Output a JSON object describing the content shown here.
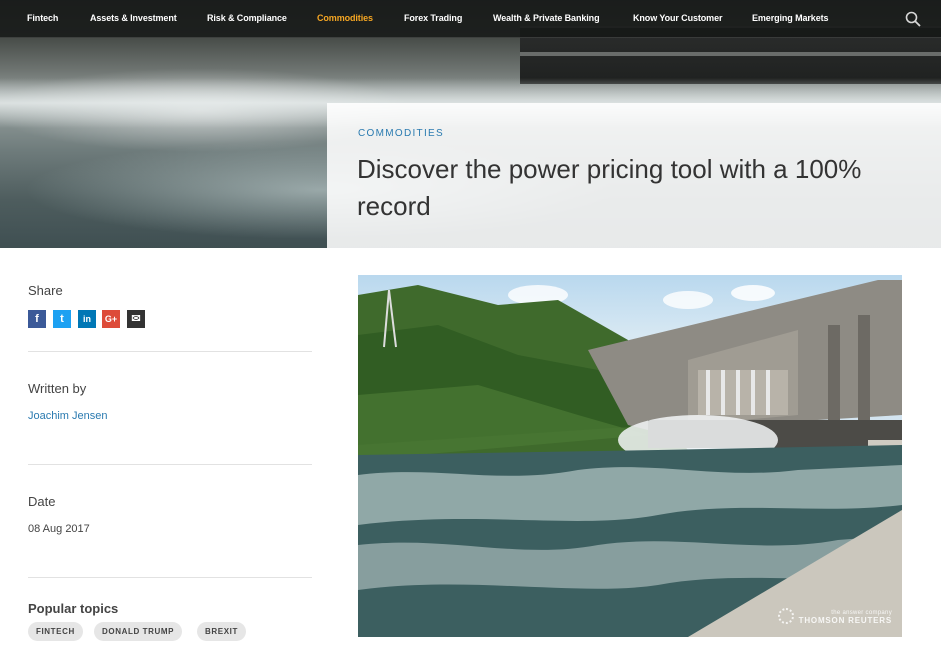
{
  "nav": {
    "items": [
      {
        "label": "Fintech",
        "active": false
      },
      {
        "label": "Assets & Investment",
        "active": false
      },
      {
        "label": "Risk & Compliance",
        "active": false
      },
      {
        "label": "Commodities",
        "active": true
      },
      {
        "label": "Forex Trading",
        "active": false
      },
      {
        "label": "Wealth & Private Banking",
        "active": false
      },
      {
        "label": "Know Your Customer",
        "active": false
      },
      {
        "label": "Emerging Markets",
        "active": false
      }
    ],
    "search_icon": "search-icon"
  },
  "hero": {
    "category": "COMMODITIES",
    "title": "Discover the power pricing tool with a 100% record"
  },
  "sidebar": {
    "share_heading": "Share",
    "share_icons": [
      {
        "name": "facebook-icon",
        "glyph": "f",
        "color": "#3b5998"
      },
      {
        "name": "twitter-icon",
        "glyph": "t",
        "color": "#1da1f2"
      },
      {
        "name": "linkedin-icon",
        "glyph": "in",
        "color": "#0077b5"
      },
      {
        "name": "google-plus-icon",
        "glyph": "G+",
        "color": "#dd4b39"
      },
      {
        "name": "email-icon",
        "glyph": "✉",
        "color": "#333333"
      }
    ],
    "written_heading": "Written by",
    "author": "Joachim Jensen",
    "date_heading": "Date",
    "date": "08 Aug 2017",
    "topics_heading": "Popular topics",
    "topics": [
      "FINTECH",
      "DONALD TRUMP",
      "BREXIT"
    ]
  },
  "image": {
    "logo_small": "the answer company",
    "logo_big": "THOMSON REUTERS"
  },
  "colors": {
    "accent_link": "#2a7ab0",
    "nav_active": "#f5a623"
  }
}
